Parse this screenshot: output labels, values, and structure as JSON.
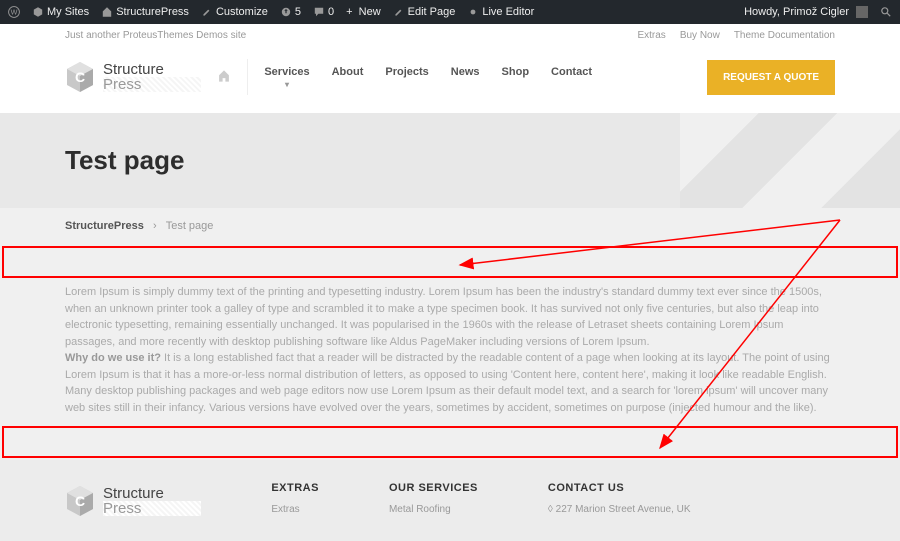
{
  "adminbar": {
    "mysites": "My Sites",
    "site": "StructurePress",
    "customize": "Customize",
    "updates": "5",
    "comments": "0",
    "new": "New",
    "edit": "Edit Page",
    "live": "Live Editor",
    "howdy": "Howdy, Primož Cigler"
  },
  "topstrip": {
    "tagline": "Just another ProteusThemes Demos site",
    "extras": "Extras",
    "buynow": "Buy Now",
    "docs": "Theme Documentation"
  },
  "logo": {
    "line1": "Structure",
    "line2": "Press"
  },
  "nav": {
    "services": "Services",
    "about": "About",
    "projects": "Projects",
    "news": "News",
    "shop": "Shop",
    "contact": "Contact"
  },
  "quote": "REQUEST A QUOTE",
  "page_title": "Test page",
  "breadcrumb": {
    "root": "StructurePress",
    "sep": "›",
    "current": "Test page"
  },
  "body": {
    "p1": "Lorem Ipsum is simply dummy text of the printing and typesetting industry. Lorem Ipsum has been the industry's standard dummy text ever since the 1500s, when an unknown printer took a galley of type and scrambled it to make a type specimen book. It has survived not only five centuries, but also the leap into electronic typesetting, remaining essentially unchanged. It was popularised in the 1960s with the release of Letraset sheets containing Lorem Ipsum passages, and more recently with desktop publishing software like Aldus PageMaker including versions of Lorem Ipsum.",
    "p2_bold": "Why do we use it?",
    "p2": " It is a long established fact that a reader will be distracted by the readable content of a page when looking at its layout. The point of using Lorem Ipsum is that it has a more-or-less normal distribution of letters, as opposed to using 'Content here, content here', making it look like readable English. Many desktop publishing packages and web page editors now use Lorem Ipsum as their default model text, and a search for 'lorem ipsum' will uncover many web sites still in their infancy. Various versions have evolved over the years, sometimes by accident, sometimes on purpose (injected humour and the like)."
  },
  "footer": {
    "extras_h": "EXTRAS",
    "extras_1": "Extras",
    "services_h": "OUR SERVICES",
    "services_1": "Metal Roofing",
    "contact_h": "CONTACT US",
    "contact_1": "227 Marion Street Avenue, UK"
  }
}
